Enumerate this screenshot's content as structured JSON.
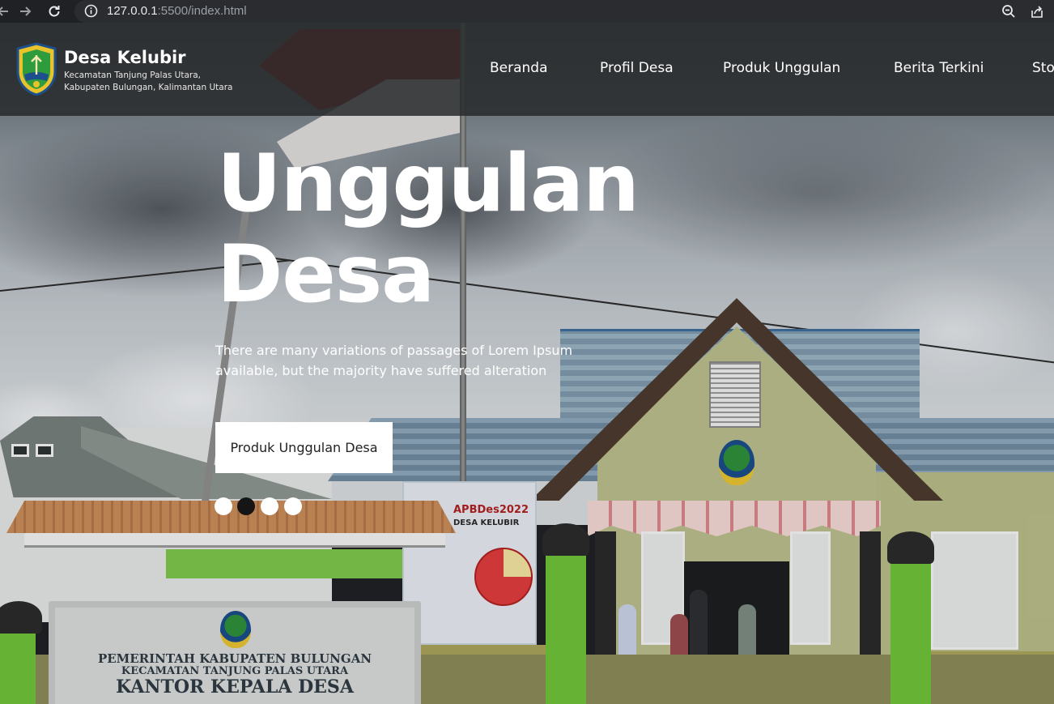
{
  "browser": {
    "url_host": "127.0.0.1",
    "url_rest": ":5500/index.html"
  },
  "site": {
    "name": "Desa Kelubir",
    "subtitle_line1": "Kecamatan Tanjung Palas Utara,",
    "subtitle_line2": "Kabupaten Bulungan, Kalimantan Utara"
  },
  "nav": {
    "items": [
      "Beranda",
      "Profil Desa",
      "Produk Unggulan",
      "Berita Terkini",
      "Sto"
    ]
  },
  "hero": {
    "title_line1": "Unggulan",
    "title_line2": "Desa",
    "desc_line1": "There are many variations of passages of Lorem Ipsum",
    "desc_line2": "available, but the majority have suffered alteration",
    "cta_label": "Produk Unggulan Desa",
    "active_slide": 2,
    "slide_count": 4
  },
  "photo_text": {
    "sign_line1": "PEMERINTAH KABUPATEN BULUNGAN",
    "sign_line2": "KECAMATAN TANJUNG PALAS UTARA",
    "sign_line3": "KANTOR KEPALA DESA",
    "banner_title": "APBDes2022",
    "banner_sub": "DESA KELUBIR"
  },
  "colors": {
    "nav_bg": "#282a2b",
    "cta_bg": "#ffffff",
    "dot_active": "#151515"
  }
}
